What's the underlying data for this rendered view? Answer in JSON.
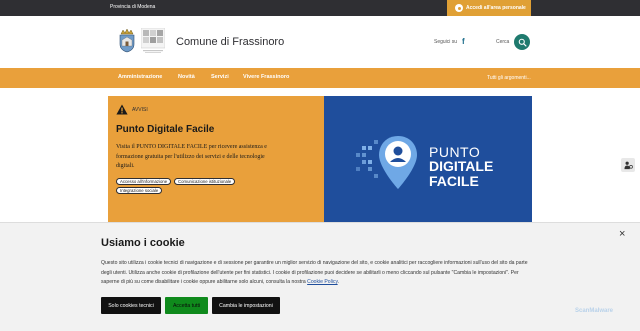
{
  "topbar": {
    "province": "Provincia di Modena",
    "login_label": "Accedi all'area personale"
  },
  "header": {
    "site_title": "Comune di Frassinoro",
    "follow_label": "Seguici su",
    "facebook_icon": "f",
    "search_label": "Cerca"
  },
  "nav": {
    "items": [
      "Amministrazione",
      "Novità",
      "Servizi",
      "Vivere Frassinoro"
    ],
    "all_topics": "Tutti gli argomenti..."
  },
  "hero": {
    "category": "AVVISI",
    "title": "Punto Digitale Facile",
    "description": "Visita il PUNTO DIGITALE FACILE per ricevere assistenza e formazione gratuita per l'utilizzo dei servizi e delle tecnologie digitali.",
    "chips": [
      "Accesso all'informazione",
      "Comunicazione istituzionale",
      "Integrazione sociale"
    ],
    "image_text": [
      "PUNTO",
      "DIGITALE",
      "FACILE"
    ]
  },
  "cookie": {
    "title": "Usiamo i cookie",
    "text": "Questo sito utilizza i cookie tecnici di navigazione e di sessione per garantire un miglior servizio di navigazione del sito, e cookie analitici per raccogliere informazioni sull'uso del sito da parte degli utenti. Utilizza anche cookie di profilazione dell'utente per fini statistici. I cookie di profilazione puoi decidere se abilitarli o meno cliccando sul pulsante \"Cambia le impostazioni\". Per saperne di più su come disabilitare i cookie oppure abilitarne solo alcuni, consulta la nostra",
    "policy_link": "Cookie Policy",
    "policy_end": ".",
    "close": "×",
    "buttons": {
      "technical_only": "Solo cookies tecnici",
      "accept_all": "Accetta tutti",
      "change_settings": "Cambia le impostazioni"
    }
  },
  "watermark": "ScanMalware",
  "colors": {
    "topbar": "#2f2f33",
    "accent_orange": "#e9a03b",
    "search_green": "#1f7a6e",
    "hero_blue": "#1f4e9c",
    "accept_green": "#0f8a1c"
  },
  "icons": {
    "login": "user-circle-icon",
    "search": "search-icon",
    "warning": "warning-triangle-icon",
    "close": "close-icon",
    "accessibility": "accessibility-icon"
  }
}
